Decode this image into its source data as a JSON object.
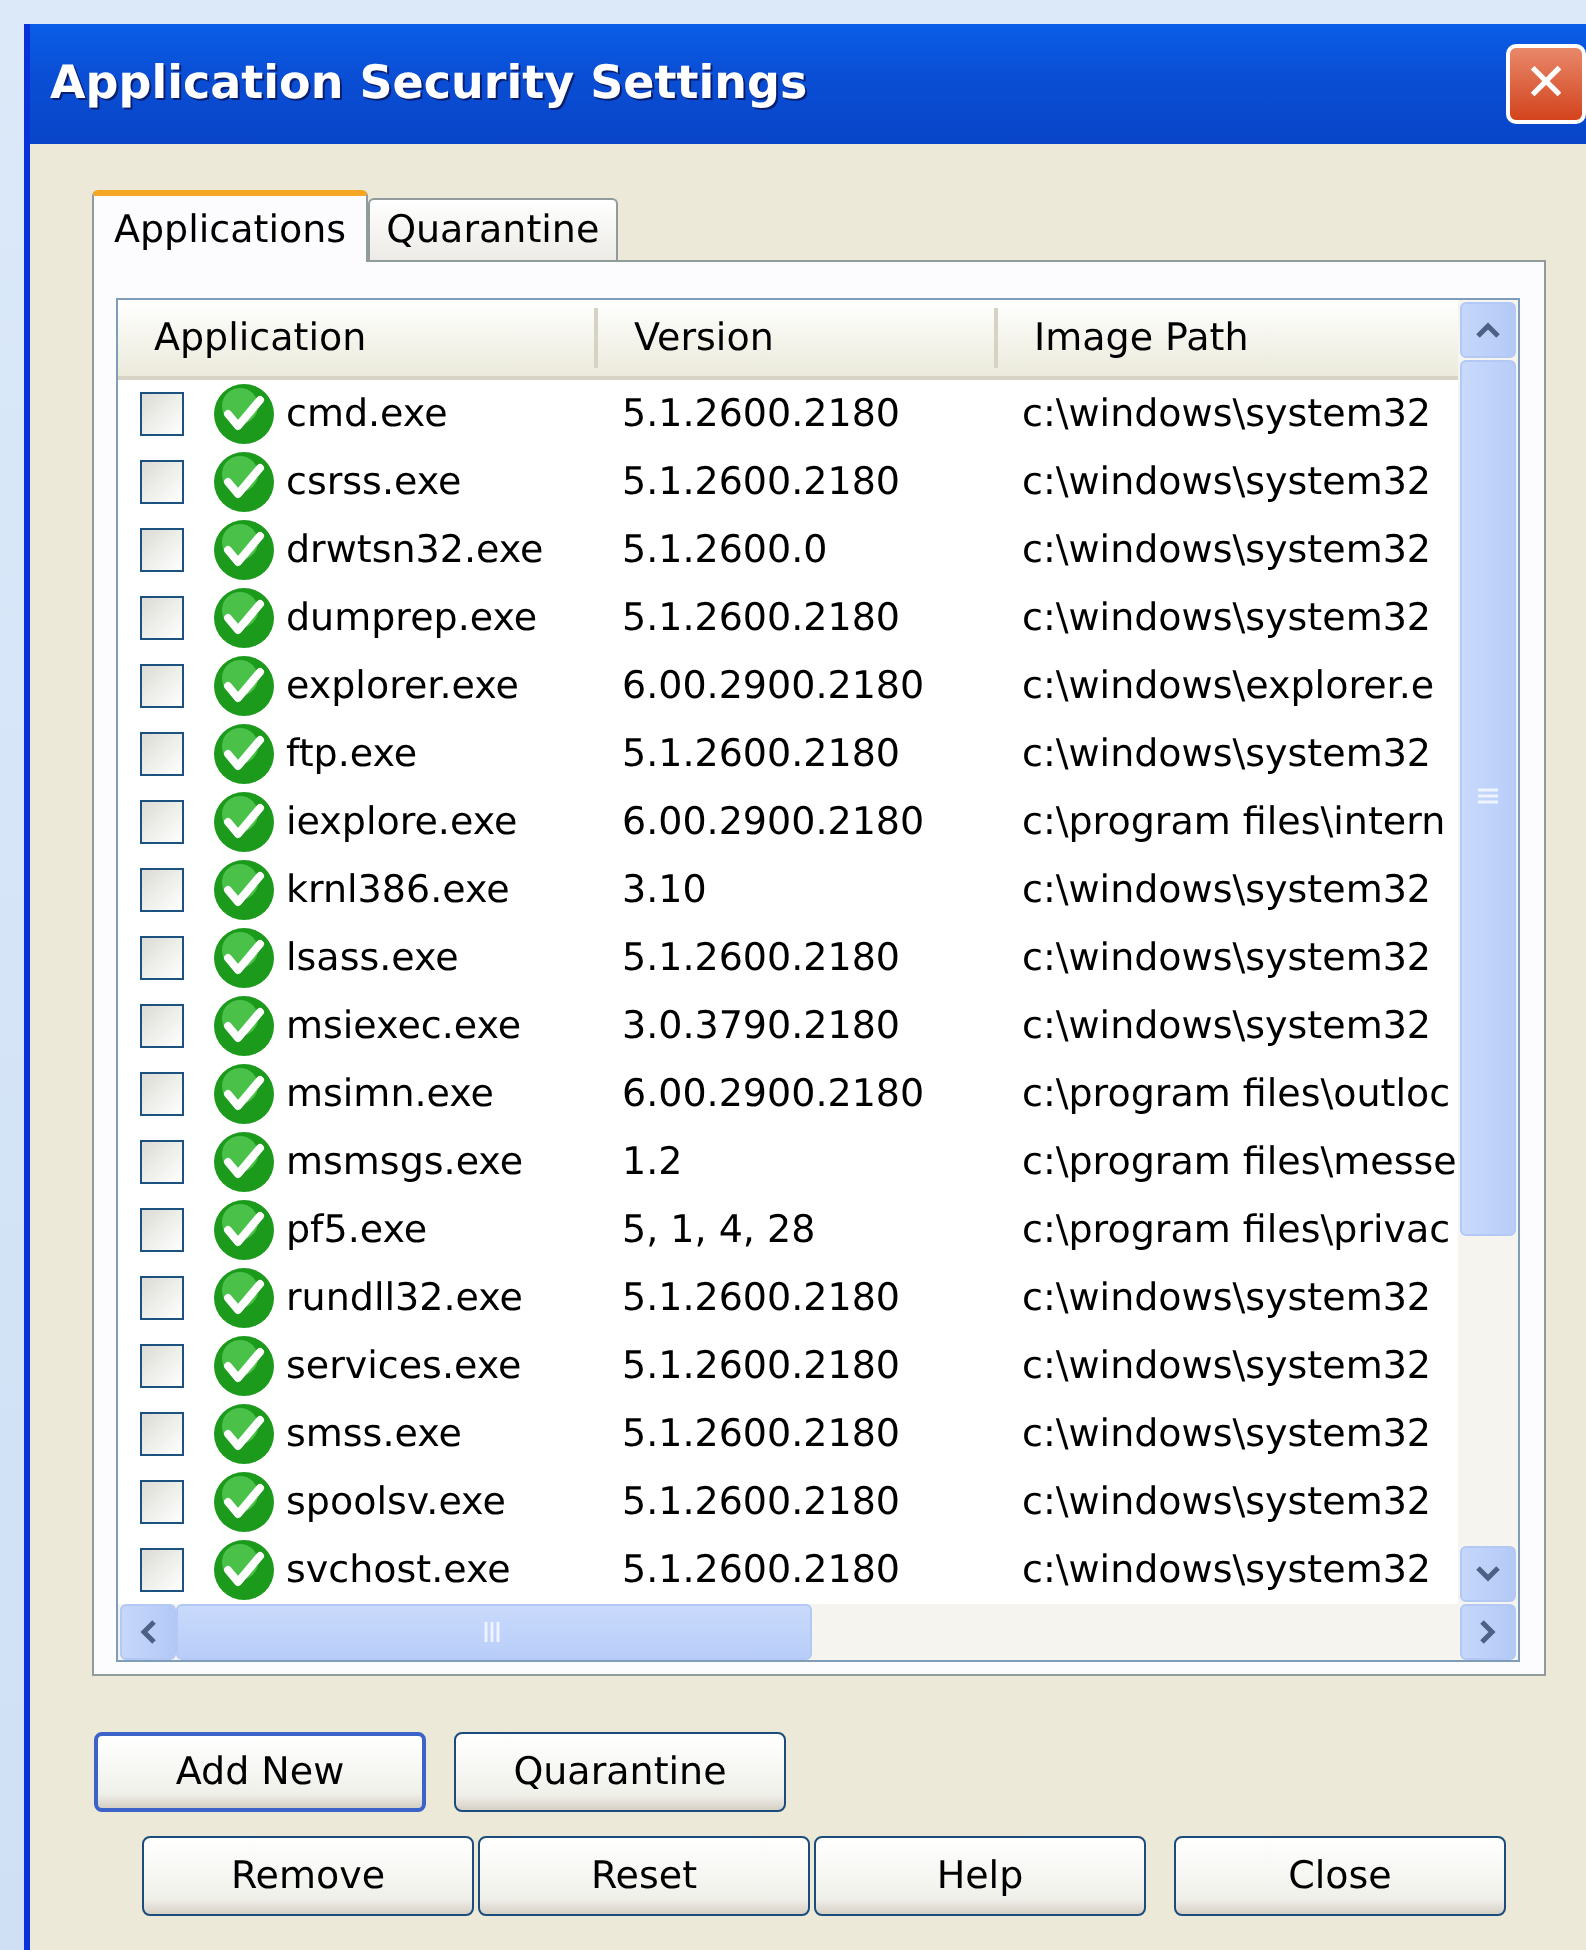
{
  "window": {
    "title": "Application Security Settings",
    "close_glyph": "✕"
  },
  "tabs": [
    {
      "label": "Applications",
      "selected": true
    },
    {
      "label": "Quarantine",
      "selected": false
    }
  ],
  "table": {
    "columns": [
      "Application",
      "Version",
      "Image Path"
    ],
    "rows": [
      {
        "checked": false,
        "name": "cmd.exe",
        "version": "5.1.2600.2180",
        "path": "c:\\windows\\system32"
      },
      {
        "checked": false,
        "name": "csrss.exe",
        "version": "5.1.2600.2180",
        "path": "c:\\windows\\system32"
      },
      {
        "checked": false,
        "name": "drwtsn32.exe",
        "version": "5.1.2600.0",
        "path": "c:\\windows\\system32"
      },
      {
        "checked": false,
        "name": "dumprep.exe",
        "version": "5.1.2600.2180",
        "path": "c:\\windows\\system32"
      },
      {
        "checked": false,
        "name": "explorer.exe",
        "version": "6.00.2900.2180",
        "path": "c:\\windows\\explorer.e"
      },
      {
        "checked": false,
        "name": "ftp.exe",
        "version": "5.1.2600.2180",
        "path": "c:\\windows\\system32"
      },
      {
        "checked": false,
        "name": "iexplore.exe",
        "version": "6.00.2900.2180",
        "path": "c:\\program files\\intern"
      },
      {
        "checked": false,
        "name": "krnl386.exe",
        "version": "3.10",
        "path": "c:\\windows\\system32"
      },
      {
        "checked": false,
        "name": "lsass.exe",
        "version": "5.1.2600.2180",
        "path": "c:\\windows\\system32"
      },
      {
        "checked": false,
        "name": "msiexec.exe",
        "version": "3.0.3790.2180",
        "path": "c:\\windows\\system32"
      },
      {
        "checked": false,
        "name": "msimn.exe",
        "version": "6.00.2900.2180",
        "path": "c:\\program files\\outloc"
      },
      {
        "checked": false,
        "name": "msmsgs.exe",
        "version": "1.2",
        "path": "c:\\program files\\messe"
      },
      {
        "checked": false,
        "name": "pf5.exe",
        "version": "5, 1, 4, 28",
        "path": "c:\\program files\\privac"
      },
      {
        "checked": false,
        "name": "rundll32.exe",
        "version": "5.1.2600.2180",
        "path": "c:\\windows\\system32"
      },
      {
        "checked": false,
        "name": "services.exe",
        "version": "5.1.2600.2180",
        "path": "c:\\windows\\system32"
      },
      {
        "checked": false,
        "name": "smss.exe",
        "version": "5.1.2600.2180",
        "path": "c:\\windows\\system32"
      },
      {
        "checked": false,
        "name": "spoolsv.exe",
        "version": "5.1.2600.2180",
        "path": "c:\\windows\\system32"
      },
      {
        "checked": false,
        "name": "svchost.exe",
        "version": "5.1.2600.2180",
        "path": "c:\\windows\\system32"
      }
    ]
  },
  "buttons": [
    {
      "label": "Add New",
      "kind": "default"
    },
    {
      "label": "Quarantine",
      "kind": "normal"
    },
    {
      "label": "Remove",
      "kind": "normal"
    },
    {
      "label": "Reset",
      "kind": "normal"
    },
    {
      "label": "Help",
      "kind": "normal"
    },
    {
      "label": "Close",
      "kind": "normal"
    }
  ]
}
